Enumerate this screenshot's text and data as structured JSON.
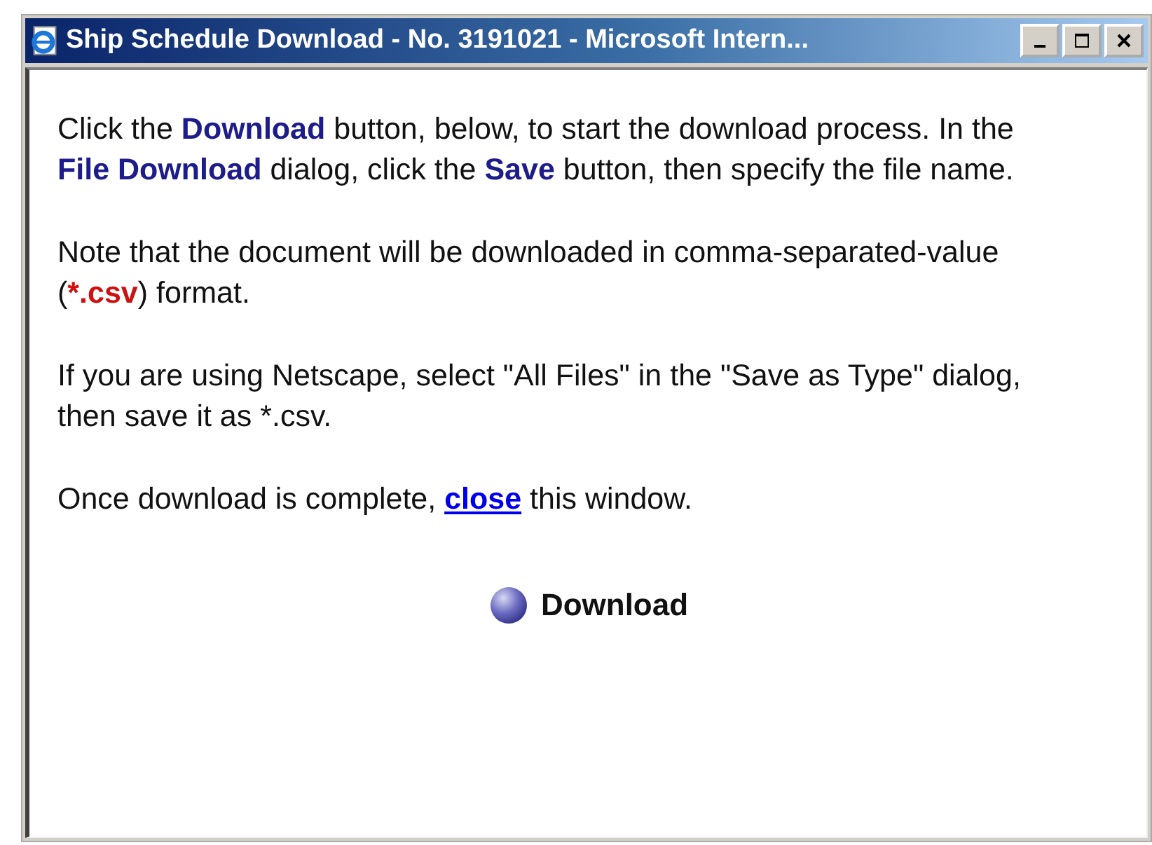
{
  "window": {
    "title": "Ship Schedule Download - No. 3191021 - Microsoft Intern..."
  },
  "paragraphs": [
    [
      {
        "kind": "plain",
        "text": "Click the "
      },
      {
        "kind": "term",
        "text": "Download"
      },
      {
        "kind": "plain",
        "text": " button, below, to start the download process. In the "
      },
      {
        "kind": "term",
        "text": "File Download"
      },
      {
        "kind": "plain",
        "text": " dialog, click the "
      },
      {
        "kind": "term",
        "text": "Save"
      },
      {
        "kind": "plain",
        "text": " button, then specify the file name."
      }
    ],
    [
      {
        "kind": "plain",
        "text": "Note that the document will be downloaded in comma-separated-value ("
      },
      {
        "kind": "file",
        "text": "*.csv"
      },
      {
        "kind": "plain",
        "text": ") format."
      }
    ],
    [
      {
        "kind": "plain",
        "text": "If you are using Netscape, select \"All Files\" in the \"Save as Type\" dialog, then save it as *.csv."
      }
    ],
    [
      {
        "kind": "plain",
        "text": "Once download is complete, "
      },
      {
        "kind": "link",
        "text": "close"
      },
      {
        "kind": "plain",
        "text": " this window."
      }
    ]
  ],
  "download_button": {
    "label": "Download"
  }
}
